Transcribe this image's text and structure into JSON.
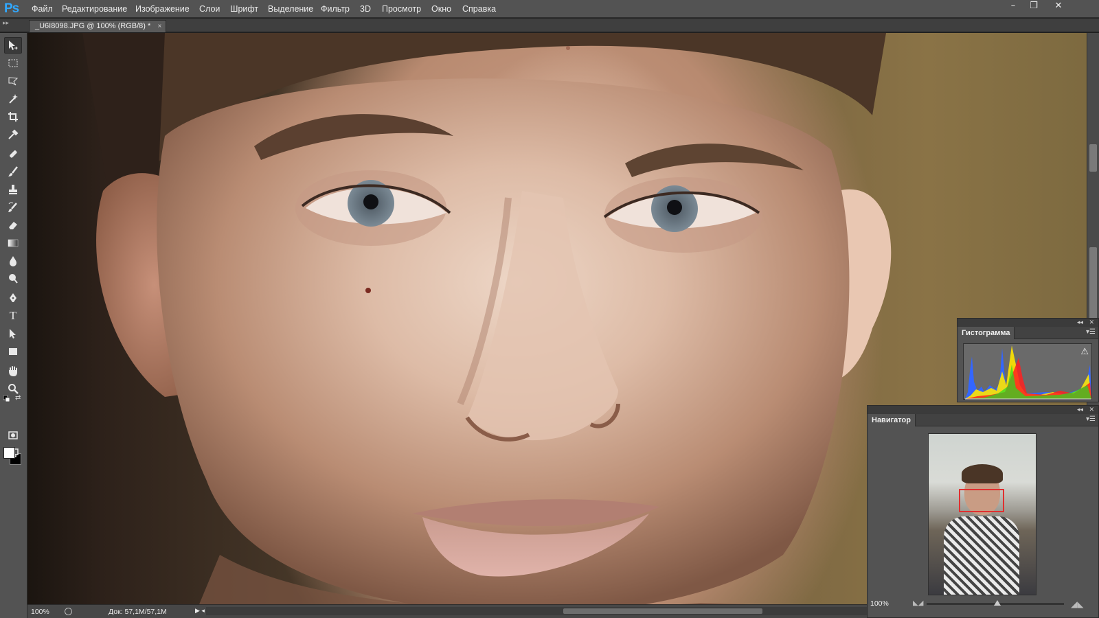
{
  "app": {
    "logo": "Ps",
    "menu": [
      "Файл",
      "Редактирование",
      "Изображение",
      "Слои",
      "Шрифт",
      "Выделение",
      "Фильтр",
      "3D",
      "Просмотр",
      "Окно",
      "Справка"
    ],
    "window_controls": {
      "minimize": "–",
      "restore": "❐",
      "close": "✕"
    }
  },
  "document_tab": {
    "title": "_U6I8098.JPG @ 100% (RGB/8) *",
    "close": "×"
  },
  "tools": [
    "move-icon",
    "rect-marquee-icon",
    "lasso-icon",
    "magic-wand-icon",
    "crop-icon",
    "eyedropper-icon",
    "healing-brush-icon",
    "brush-icon",
    "clone-stamp-icon",
    "history-brush-icon",
    "eraser-icon",
    "gradient-icon",
    "blur-icon",
    "dodge-icon",
    "pen-icon",
    "type-icon",
    "path-select-icon",
    "rectangle-icon",
    "hand-icon",
    "zoom-icon"
  ],
  "type_tool_glyph": "T",
  "colors": {
    "foreground": "#ffffff",
    "background": "#000000",
    "accent": "#31a8ff",
    "nav_frame": "#e03030"
  },
  "status": {
    "zoom": "100%",
    "doc": "Док: 57,1M/57,1M"
  },
  "histogram": {
    "tab": "Гистограмма",
    "warning": "⚠"
  },
  "navigator": {
    "tab": "Навигатор",
    "zoom": "100%"
  }
}
